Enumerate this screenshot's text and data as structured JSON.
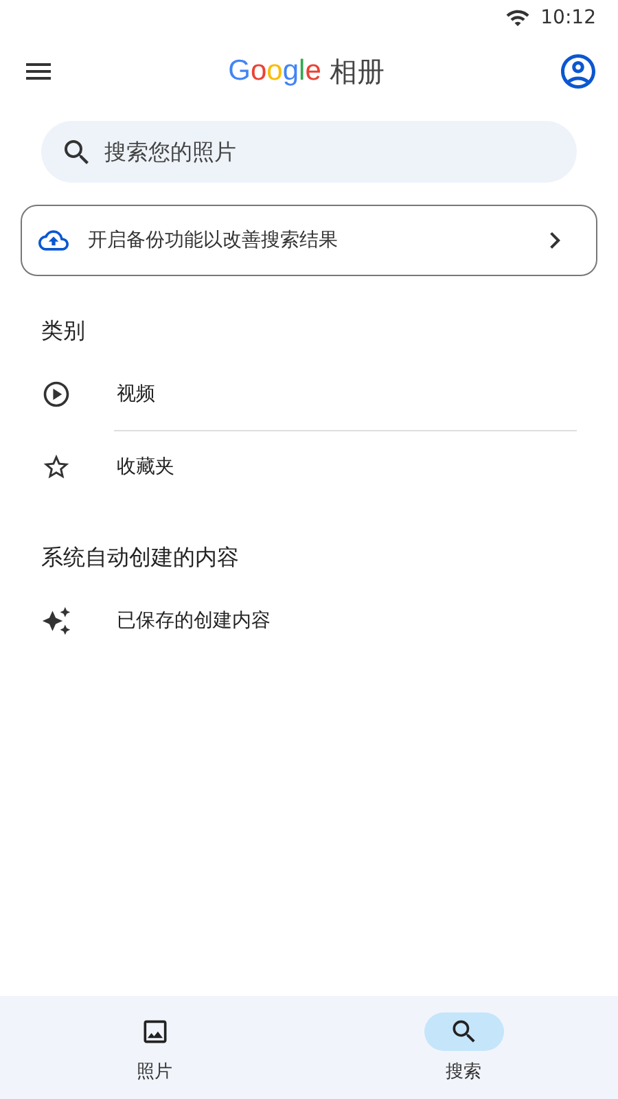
{
  "status_bar": {
    "time": "10:12"
  },
  "app_bar": {
    "logo": "Google",
    "title": "相册"
  },
  "search": {
    "placeholder": "搜索您的照片"
  },
  "backup_banner": {
    "text": "开启备份功能以改善搜索结果"
  },
  "sections": [
    {
      "title": "类别",
      "items": [
        {
          "label": "视频"
        },
        {
          "label": "收藏夹"
        }
      ]
    },
    {
      "title": "系统自动创建的内容",
      "items": [
        {
          "label": "已保存的创建内容"
        }
      ]
    }
  ],
  "bottom_nav": [
    {
      "label": "照片",
      "selected": false
    },
    {
      "label": "搜索",
      "selected": true
    }
  ]
}
